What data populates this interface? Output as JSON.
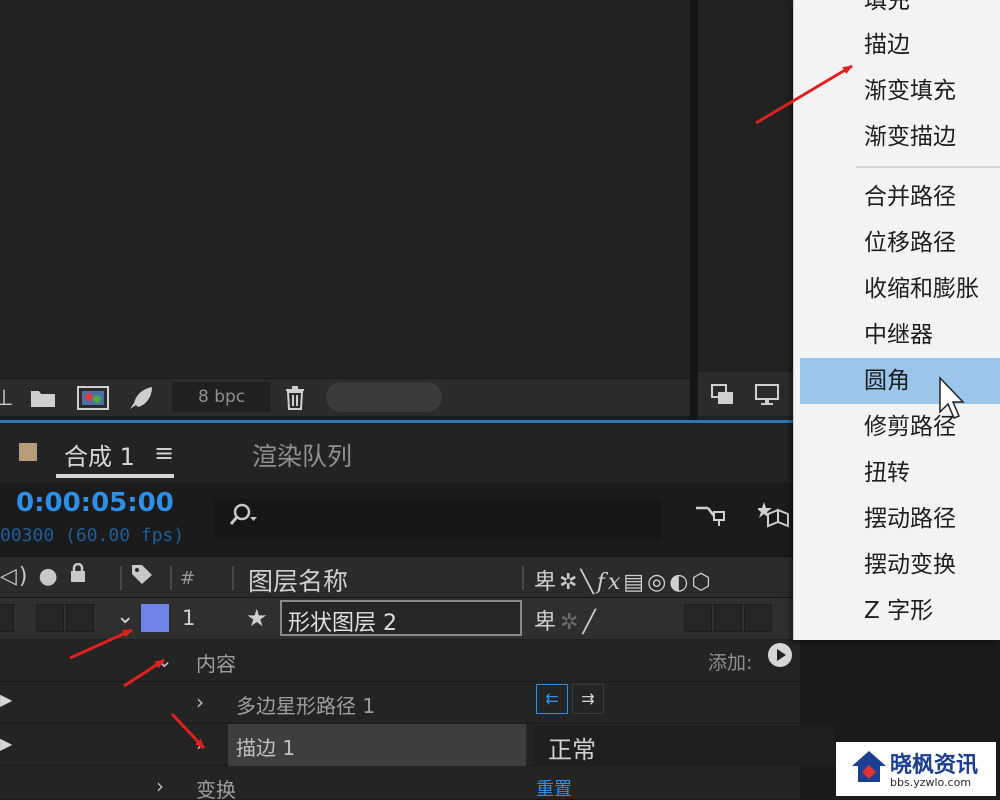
{
  "colors": {
    "accent_blue": "#2f8ee5",
    "label_color": "#7083ea",
    "menu_highlight": "#9bc6ec",
    "arrow_red": "#e02020",
    "comp_swatch": "#b79e7a"
  },
  "viewer_toolbar": {
    "bpc_label": "8 bpc",
    "icons": [
      "pin-icon",
      "folder-icon",
      "image-icon",
      "rocket-icon",
      "trash-icon"
    ]
  },
  "right_toolbar": {
    "icons": [
      "layers-icon",
      "monitor-icon"
    ]
  },
  "tabs": {
    "composition_label": "合成",
    "composition_number": "1",
    "menu_glyph": "≡",
    "render_queue_label": "渲染队列"
  },
  "timeline": {
    "timecode": "0:00:05:00",
    "frames_fps": "00300 (60.00 fps)",
    "search_placeholder": ""
  },
  "column_header": {
    "hash": "#",
    "layer_name": "图层名称"
  },
  "layer": {
    "number": "1",
    "name": "形状图层 2"
  },
  "properties": {
    "contents": "内容",
    "add_label": "添加:",
    "polystar_path": "多边星形路径 1",
    "stroke": "描边 1",
    "stroke_mode": "正常",
    "transform": "变换",
    "reset_label": "重置"
  },
  "context_menu": {
    "items": [
      {
        "label": "填充"
      },
      {
        "label": "描边"
      },
      {
        "label": "渐变填充"
      },
      {
        "label": "渐变描边"
      },
      {
        "label": "合并路径"
      },
      {
        "label": "位移路径"
      },
      {
        "label": "收缩和膨胀"
      },
      {
        "label": "中继器"
      },
      {
        "label": "圆角",
        "highlighted": true
      },
      {
        "label": "修剪路径"
      },
      {
        "label": "扭转"
      },
      {
        "label": "摆动路径"
      },
      {
        "label": "摆动变换"
      },
      {
        "label": "Z 字形"
      }
    ]
  },
  "watermark": {
    "title": "晓枫资讯",
    "url": "bbs.yzwlo.com"
  }
}
